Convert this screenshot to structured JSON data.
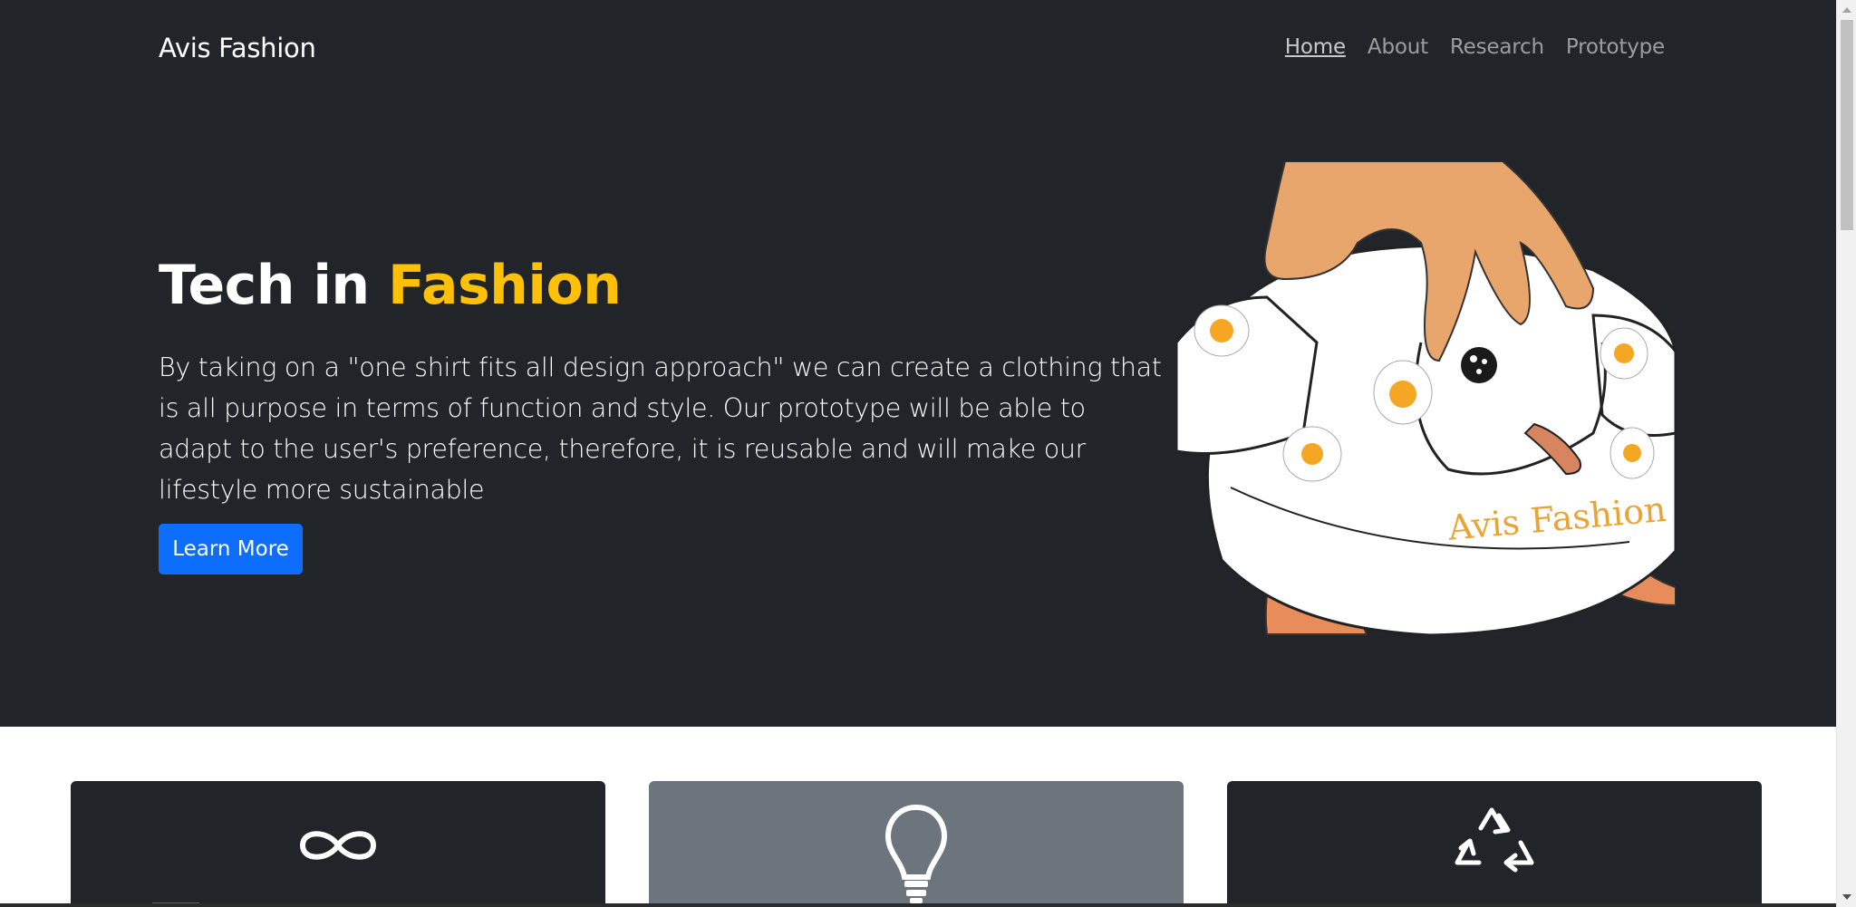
{
  "navbar": {
    "brand": "Avis Fashion",
    "links": [
      {
        "label": "Home",
        "active": true
      },
      {
        "label": "About",
        "active": false
      },
      {
        "label": "Research",
        "active": false
      },
      {
        "label": "Prototype",
        "active": false
      }
    ]
  },
  "hero": {
    "title_main": "Tech in ",
    "title_accent": "Fashion",
    "description": "By taking on a \"one shirt fits all design approach\" we can create a clothing that is all purpose in terms of function and style. Our prototype will be able to adapt to the user's preference, therefore, it is reusable and will make our lifestyle more sustainable",
    "cta_label": "Learn More",
    "image_shirt_text": "Avis Fashion"
  },
  "features": [
    {
      "icon": "infinity-icon",
      "style": "dark"
    },
    {
      "icon": "lightbulb-icon",
      "style": "gray"
    },
    {
      "icon": "recycle-icon",
      "style": "dark"
    }
  ],
  "colors": {
    "dark_bg": "#212529",
    "accent": "#ffc107",
    "primary": "#0d6efd",
    "gray_card": "#6c757d"
  }
}
